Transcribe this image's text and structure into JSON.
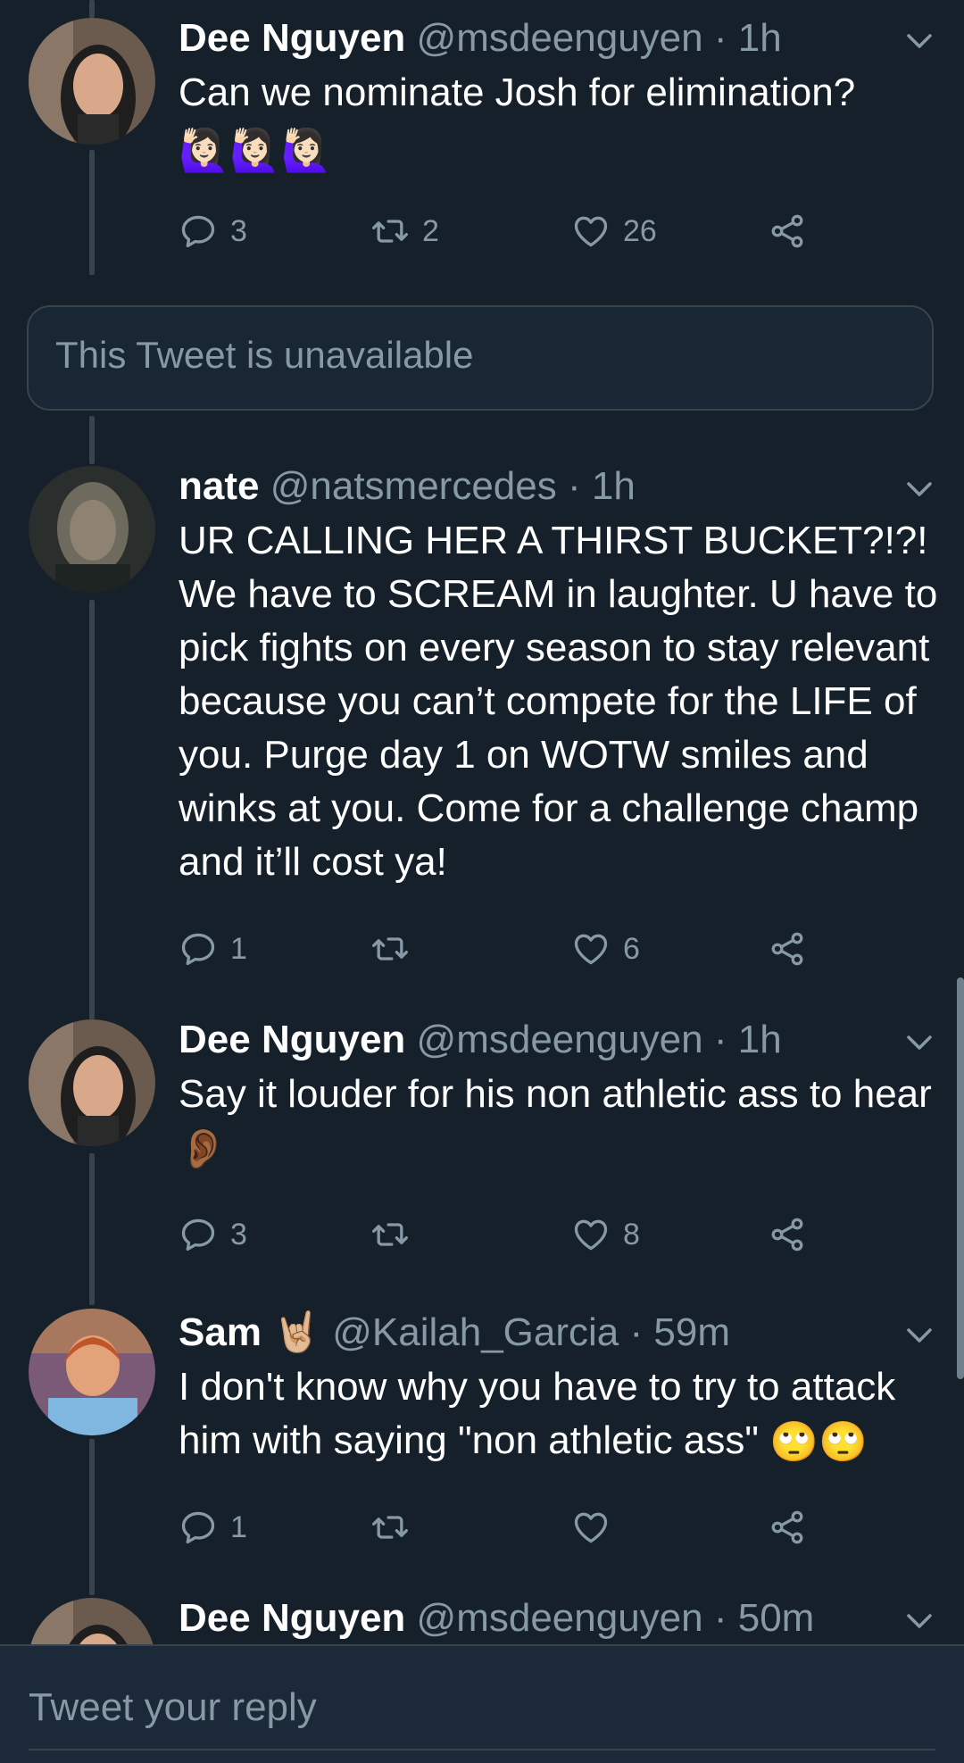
{
  "tweets": [
    {
      "name": "Dee Nguyen",
      "handle": "@msdeenguyen",
      "time": "· 1h",
      "text": "Can we nominate Josh for elimination?",
      "emoji": "🙋🏻‍♀️🙋🏻‍♀️🙋🏻‍♀️",
      "replies": "3",
      "retweets": "2",
      "likes": "26"
    },
    {
      "name": "nate",
      "handle": "@natsmercedes",
      "time": "· 1h",
      "text": "UR CALLING HER A THIRST BUCKET?!?! We have to SCREAM in laughter. U have to pick fights on every season to stay relevant because you can’t compete for the LIFE of you. Purge day 1 on WOTW smiles and winks at you. Come for a challenge champ and it’ll cost ya!",
      "replies": "1",
      "retweets": "",
      "likes": "6"
    },
    {
      "name": "Dee Nguyen",
      "handle": "@msdeenguyen",
      "time": "· 1h",
      "text": "Say it louder for his non athletic ass to hear",
      "emoji": "👂🏾",
      "replies": "3",
      "retweets": "",
      "likes": "8"
    },
    {
      "name": "Sam",
      "name_emoji": "🤘🏼",
      "handle": "@Kailah_Garcia",
      "time": "· 59m",
      "text": "I don't know why you have to try to attack him with saying \"non athletic ass\"",
      "emoji": "🙄🙄",
      "replies": "1",
      "retweets": "",
      "likes": ""
    },
    {
      "name": "Dee Nguyen",
      "handle": "@msdeenguyen",
      "time": "· 50m"
    }
  ],
  "unavailable_text": "This Tweet is unavailable",
  "reply_placeholder": "Tweet your reply",
  "icons": [
    "reply-icon",
    "retweet-icon",
    "like-icon",
    "share-icon",
    "chevron-down-icon"
  ],
  "colors": {
    "background": "#15202b",
    "secondary_text": "#8899a6",
    "border": "#38444d"
  }
}
